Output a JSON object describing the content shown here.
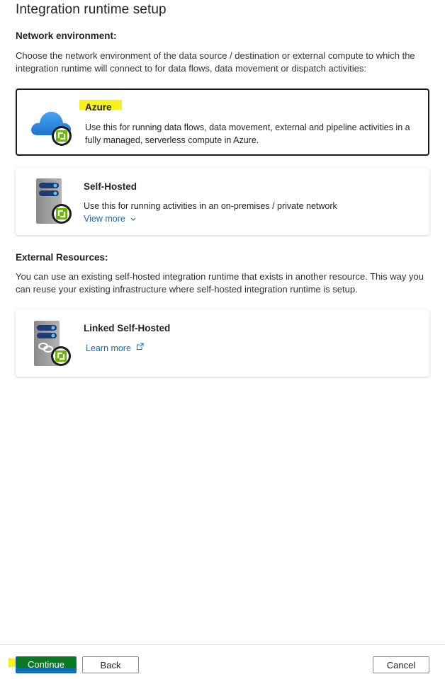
{
  "page": {
    "title": "Integration runtime setup"
  },
  "network": {
    "heading": "Network environment:",
    "description": "Choose the network environment of the data source / destination or external compute to which the integration runtime will connect to for data flows, data movement or dispatch activities:"
  },
  "options": [
    {
      "title": "Azure",
      "description": "Use this for running data flows, data movement, external and pipeline activities in a fully managed, serverless compute in Azure.",
      "selected": true,
      "icon": "azure-cloud-icon"
    },
    {
      "title": "Self-Hosted",
      "description": "Use this for running activities in an on-premises / private network",
      "link": "View more",
      "icon": "server-icon"
    }
  ],
  "external": {
    "heading": "External Resources:",
    "description": "You can use an existing self-hosted integration runtime that exists in another resource. This way you can reuse your existing infrastructure where self-hosted integration runtime is setup.",
    "card": {
      "title": "Linked Self-Hosted",
      "link": "Learn more",
      "icon": "linked-server-icon"
    }
  },
  "footer": {
    "continue": "Continue",
    "back": "Back",
    "cancel": "Cancel"
  },
  "colors": {
    "accent": "#0f6cbd",
    "highlight": "#f7f11d",
    "runtime_badge": "#6bb700"
  }
}
